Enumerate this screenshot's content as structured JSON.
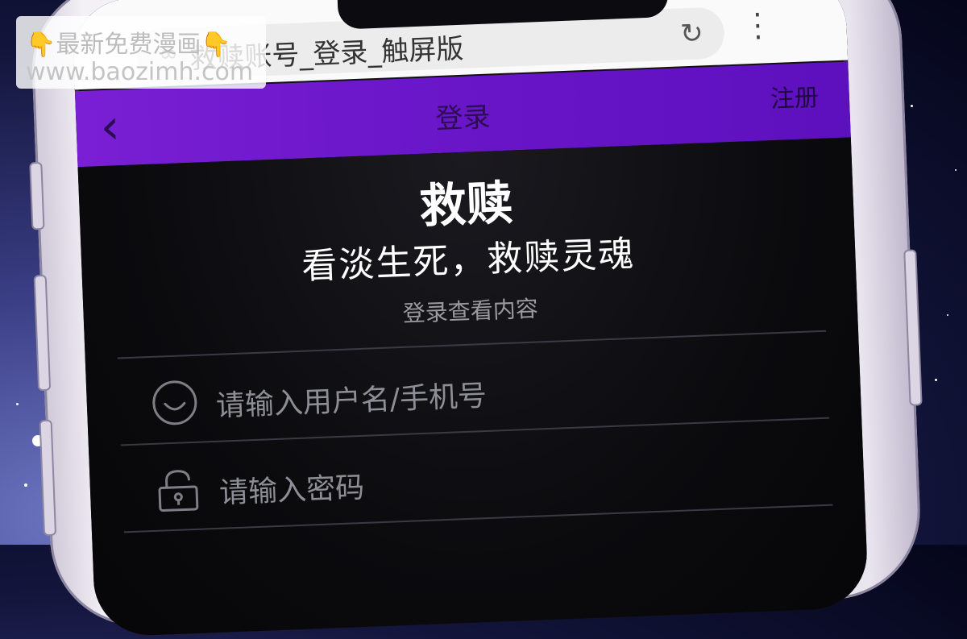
{
  "browser": {
    "page_title": "救赎账号_登录_触屏版",
    "secure_icon": "mask-icon",
    "reload_icon": "reload-icon",
    "menu_icon": "more-vertical-icon"
  },
  "nav": {
    "back_icon": "chevron-left-icon",
    "title": "登录",
    "register_label": "注册",
    "bar_color": "#6a16c9"
  },
  "login": {
    "app_name": "救赎",
    "slogan": "看淡生死，救赎灵魂",
    "hint": "登录查看内容",
    "username_placeholder": "请输入用户名/手机号",
    "password_placeholder": "请输入密码",
    "username_icon": "smiley-icon",
    "password_icon": "lock-icon"
  },
  "watermark": {
    "line1": "👇最新免费漫画👇",
    "line2": "www.baozimh.com"
  }
}
